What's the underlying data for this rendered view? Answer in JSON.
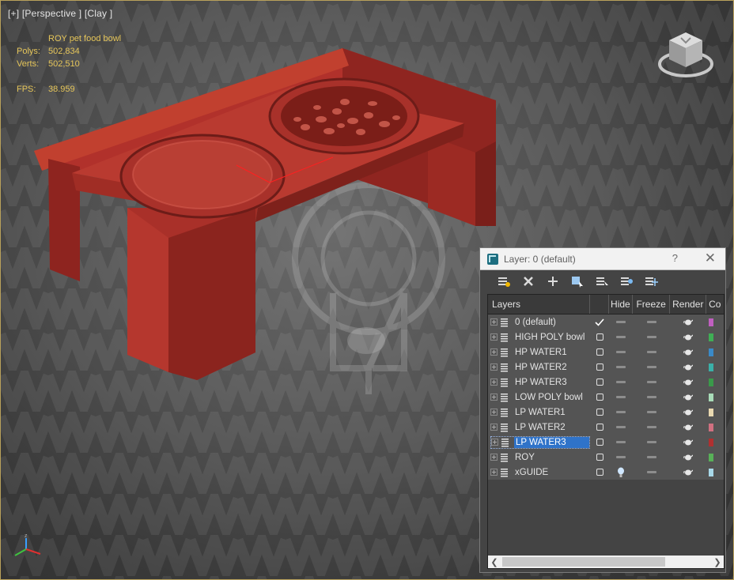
{
  "viewport": {
    "label_plus": "[+]",
    "label_view": "[Perspective ]",
    "label_shade": "[Clay ]",
    "stats": {
      "object": "ROY pet food bowl",
      "polys_label": "Polys:",
      "polys_value": "502,834",
      "verts_label": "Verts:",
      "verts_value": "502,510",
      "fps_label": "FPS:",
      "fps_value": "38.959"
    }
  },
  "layer_dialog": {
    "title": "Layer: 0 (default)",
    "help": "?",
    "close": "✕",
    "toolbar": [
      "create-layer-icon",
      "delete-layer-icon",
      "add-selection-icon",
      "select-objects-icon",
      "highlight-icon",
      "hide-all-icon",
      "freeze-all-icon"
    ],
    "columns": {
      "name": "Layers",
      "hide": "Hide",
      "freeze": "Freeze",
      "render": "Render",
      "color": "Co"
    },
    "layers": [
      {
        "name": "0 (default)",
        "current": true,
        "selected": false,
        "hidden_icon": "dash",
        "color": "#c05fc0"
      },
      {
        "name": "HIGH POLY bowl",
        "current": false,
        "selected": false,
        "hidden_icon": "dash",
        "color": "#3fae55"
      },
      {
        "name": "HP WATER1",
        "current": false,
        "selected": false,
        "hidden_icon": "dash",
        "color": "#3a8ac8"
      },
      {
        "name": "HP WATER2",
        "current": false,
        "selected": false,
        "hidden_icon": "dash",
        "color": "#3ab0a8"
      },
      {
        "name": "HP WATER3",
        "current": false,
        "selected": false,
        "hidden_icon": "dash",
        "color": "#3a9a4a"
      },
      {
        "name": "LOW POLY bowl",
        "current": false,
        "selected": false,
        "hidden_icon": "dash",
        "color": "#a8dcb8"
      },
      {
        "name": "LP WATER1",
        "current": false,
        "selected": false,
        "hidden_icon": "dash",
        "color": "#e8d8b0"
      },
      {
        "name": "LP WATER2",
        "current": false,
        "selected": false,
        "hidden_icon": "dash",
        "color": "#d07080"
      },
      {
        "name": "LP WATER3",
        "current": false,
        "selected": true,
        "hidden_icon": "dash",
        "color": "#b03030"
      },
      {
        "name": "ROY",
        "current": false,
        "selected": false,
        "hidden_icon": "dash",
        "color": "#58b058"
      },
      {
        "name": "xGUIDE",
        "current": false,
        "selected": false,
        "hidden_icon": "bulb",
        "color": "#a8d8e8"
      }
    ]
  }
}
